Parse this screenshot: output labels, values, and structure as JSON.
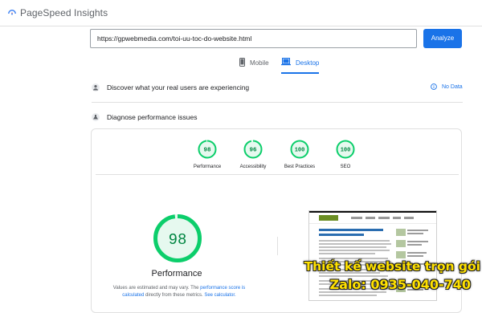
{
  "app": {
    "title": "PageSpeed Insights"
  },
  "search": {
    "url": "https://gpwebmedia.com/toi-uu-toc-do-website.html",
    "button_label": "Analyze"
  },
  "tabs": [
    {
      "label": "Mobile",
      "active": false
    },
    {
      "label": "Desktop",
      "active": true
    }
  ],
  "field_data": {
    "heading": "Discover what your real users are experiencing",
    "status": "No Data"
  },
  "diagnose": {
    "heading": "Diagnose performance issues"
  },
  "scores": [
    {
      "value": "98",
      "label": "Performance"
    },
    {
      "value": "96",
      "label": "Accessibility"
    },
    {
      "value": "100",
      "label": "Best Practices"
    },
    {
      "value": "100",
      "label": "SEO"
    }
  ],
  "performance": {
    "score": "98",
    "title": "Performance",
    "note_prefix": "Values are estimated and may vary. The ",
    "note_link1": "performance score is calculated",
    "note_mid": " directly from these metrics. ",
    "note_link2": "See calculator."
  },
  "watermark": {
    "line1": "Thiết kế website trọn gói",
    "line2": "Zalo: 0935-040-740"
  },
  "colors": {
    "accent": "#1a73e8",
    "pass": "#0cce6b",
    "pass_text": "#018642",
    "pass_bg": "#e6f9ef"
  }
}
